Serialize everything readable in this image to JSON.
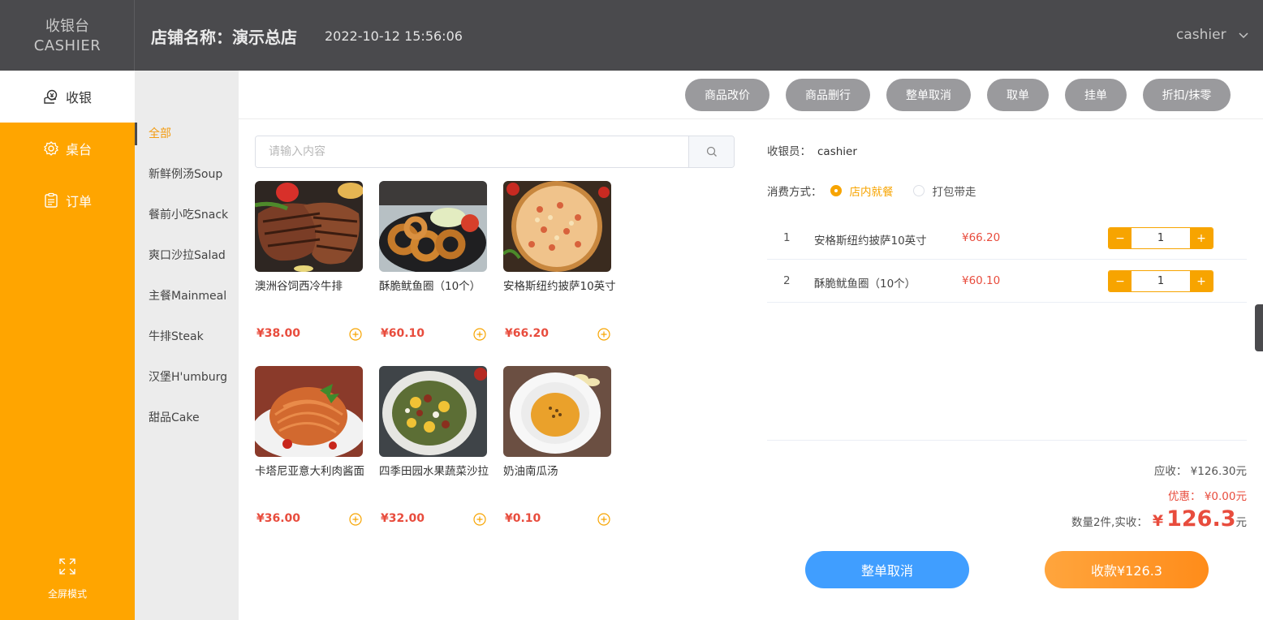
{
  "header": {
    "brand_cn": "收银台",
    "brand_en": "CASHIER",
    "store_name": "店铺名称：演示总店",
    "datetime": "2022-10-12 15:56:06",
    "user": "cashier"
  },
  "nav": {
    "items": [
      {
        "label": "收银",
        "icon": "cashier-icon"
      },
      {
        "label": "桌台",
        "icon": "table-icon"
      },
      {
        "label": "订单",
        "icon": "order-icon"
      }
    ],
    "fullscreen_label": "全屏模式"
  },
  "categories": [
    "全部",
    "新鲜例汤Soup",
    "餐前小吃Snack",
    "爽口沙拉Salad",
    "主餐Mainmeal",
    "牛排Steak",
    "汉堡H'umburg",
    "甜品Cake"
  ],
  "toolbar": {
    "buttons": [
      "商品改价",
      "商品删行",
      "整单取消",
      "取单",
      "挂单",
      "折扣/抹零"
    ]
  },
  "search": {
    "placeholder": "请输入内容",
    "value": ""
  },
  "products": [
    {
      "name": "澳洲谷饲西冷牛排",
      "price": "¥38.00"
    },
    {
      "name": "酥脆鱿鱼圈（10个）",
      "price": "¥60.10"
    },
    {
      "name": "安格斯纽约披萨10英寸",
      "price": "¥66.20"
    },
    {
      "name": "卡塔尼亚意大利肉酱面",
      "price": "¥36.00"
    },
    {
      "name": "四季田园水果蔬菜沙拉",
      "price": "¥32.00"
    },
    {
      "name": "奶油南瓜汤",
      "price": "¥0.10"
    }
  ],
  "order": {
    "cashier_label": "收银员：",
    "cashier_value": "cashier",
    "mode_label": "消费方式：",
    "mode_options": [
      "店内就餐",
      "打包带走"
    ],
    "mode_selected": "店内就餐",
    "items": [
      {
        "index": "1",
        "name": "安格斯纽约披萨10英寸",
        "price": "¥66.20",
        "qty": "1"
      },
      {
        "index": "2",
        "name": "酥脆鱿鱼圈（10个）",
        "price": "¥60.10",
        "qty": "1"
      }
    ],
    "stepper_minus": "−",
    "stepper_plus": "+",
    "due_text": "应收： ¥126.30元",
    "discount_text": "优惠： ¥0.00元",
    "paid_prefix": "数量2件,实收：",
    "paid_currency": "¥",
    "paid_amount": "126.3",
    "paid_unit": "元",
    "cancel_button": "整单取消",
    "pay_button": "收款¥126.3"
  },
  "colors": {
    "header_bg": "#4a4a4d",
    "nav_bg": "#ffa500",
    "category_bg": "#ececec",
    "toolbar_button": "#9a9a9d",
    "price_red": "#e84c3d",
    "accent_orange": "#f7a400",
    "cancel_blue": "#409eff"
  }
}
